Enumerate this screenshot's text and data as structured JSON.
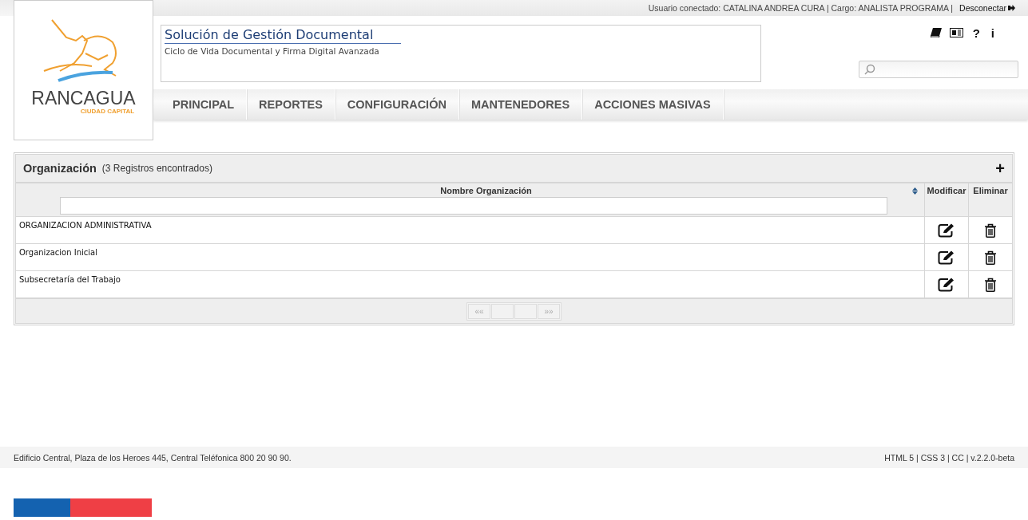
{
  "logo": {
    "name": "RANCAGUA",
    "tagline": "CIUDAD CAPITAL"
  },
  "top_bar": {
    "user": "Usuario conectado: CATALINA ANDREA CURA | Cargo: ANALISTA PROGRAMA |",
    "logout": "Desconectar"
  },
  "app": {
    "title": "Solución de Gestión Documental",
    "subtitle": "Ciclo de Vida Documental y Firma Digital Avanzada"
  },
  "help_icons": [
    {
      "kind": "book"
    },
    {
      "kind": "news"
    },
    {
      "kind": "help",
      "label": "?"
    },
    {
      "kind": "info",
      "label": "i"
    }
  ],
  "nav": [
    {
      "label": "PRINCIPAL"
    },
    {
      "label": "REPORTES"
    },
    {
      "label": "CONFIGURACIÓN"
    },
    {
      "label": "MANTENEDORES"
    },
    {
      "label": "ACCIONES MASIVAS"
    }
  ],
  "panel": {
    "title": "Organización",
    "count": "(3 Registros encontrados)",
    "add": "+"
  },
  "table": {
    "columns": [
      "Nombre Organización",
      "Modificar",
      "Eliminar"
    ],
    "rows": [
      {
        "name": "ORGANIZACION ADMINISTRATIVA"
      },
      {
        "name": "Organizacion Inicial"
      },
      {
        "name": "Subsecretaría del Trabajo"
      }
    ]
  },
  "pager": {
    "first": "««",
    "last": "»»"
  },
  "footer": {
    "address": "Edificio Central, Plaza de los Heroes 445, Central Teléfonica 800 20 90 90.",
    "version": "HTML 5 | CSS 3 | CC | v.2.2.0-beta"
  }
}
